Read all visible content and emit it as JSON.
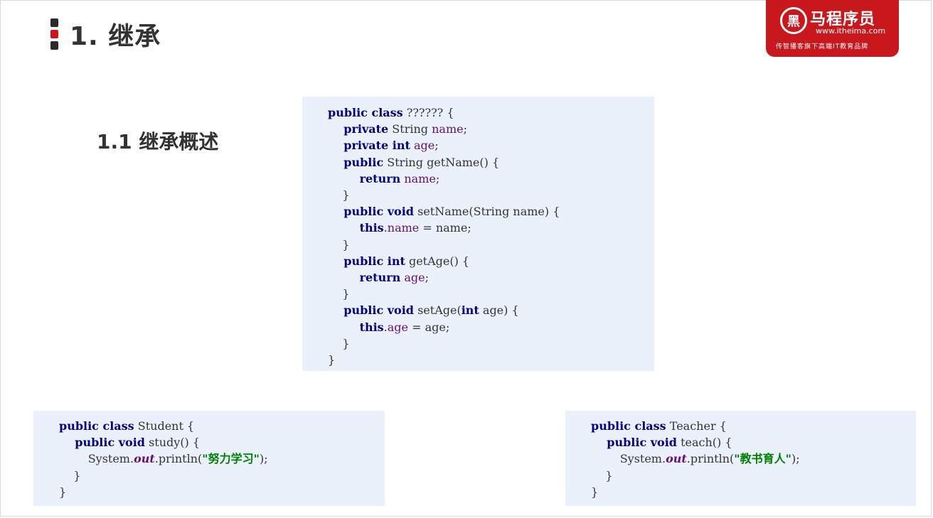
{
  "slide": {
    "title": "1. 继承",
    "subtitle": "1.1 继承概述"
  },
  "logo": {
    "icon_text": "黑",
    "name": "马程序员",
    "url": "www.itheima.com",
    "tagline": "传智播客旗下高端IT教育品牌"
  },
  "parent_code": {
    "lines": [
      [
        {
          "t": "public class",
          "c": "kw"
        },
        {
          "t": " ?????? {",
          "c": "plain"
        }
      ],
      [
        {
          "t": "    private",
          "c": "kw"
        },
        {
          "t": " String ",
          "c": "plain"
        },
        {
          "t": "name",
          "c": "fld"
        },
        {
          "t": ";",
          "c": "plain"
        }
      ],
      [
        {
          "t": "    private int",
          "c": "kw"
        },
        {
          "t": " ",
          "c": "plain"
        },
        {
          "t": "age",
          "c": "fld"
        },
        {
          "t": ";",
          "c": "plain"
        }
      ],
      [
        {
          "t": "    public",
          "c": "kw"
        },
        {
          "t": " String getName() {",
          "c": "plain"
        }
      ],
      [
        {
          "t": "        return",
          "c": "kw"
        },
        {
          "t": " ",
          "c": "plain"
        },
        {
          "t": "name",
          "c": "fld"
        },
        {
          "t": ";",
          "c": "plain"
        }
      ],
      [
        {
          "t": "    }",
          "c": "plain"
        }
      ],
      [
        {
          "t": "    public void",
          "c": "kw"
        },
        {
          "t": " setName(String name) {",
          "c": "plain"
        }
      ],
      [
        {
          "t": "        this",
          "c": "kw"
        },
        {
          "t": ".",
          "c": "plain"
        },
        {
          "t": "name",
          "c": "fld"
        },
        {
          "t": " = name;",
          "c": "plain"
        }
      ],
      [
        {
          "t": "    }",
          "c": "plain"
        }
      ],
      [
        {
          "t": "    public int",
          "c": "kw"
        },
        {
          "t": " getAge() {",
          "c": "plain"
        }
      ],
      [
        {
          "t": "        return",
          "c": "kw"
        },
        {
          "t": " ",
          "c": "plain"
        },
        {
          "t": "age",
          "c": "fld"
        },
        {
          "t": ";",
          "c": "plain"
        }
      ],
      [
        {
          "t": "    }",
          "c": "plain"
        }
      ],
      [
        {
          "t": "    public void",
          "c": "kw"
        },
        {
          "t": " setAge(",
          "c": "plain"
        },
        {
          "t": "int",
          "c": "kw"
        },
        {
          "t": " age) {",
          "c": "plain"
        }
      ],
      [
        {
          "t": "        this",
          "c": "kw"
        },
        {
          "t": ".",
          "c": "plain"
        },
        {
          "t": "age",
          "c": "fld"
        },
        {
          "t": " = age;",
          "c": "plain"
        }
      ],
      [
        {
          "t": "    }",
          "c": "plain"
        }
      ],
      [
        {
          "t": "}",
          "c": "plain"
        }
      ]
    ]
  },
  "student_code": {
    "lines": [
      [
        {
          "t": "public class",
          "c": "kw"
        },
        {
          "t": " Student {",
          "c": "plain"
        }
      ],
      [
        {
          "t": "    public void",
          "c": "kw"
        },
        {
          "t": " study() {",
          "c": "plain"
        }
      ],
      [
        {
          "t": "        System.",
          "c": "plain"
        },
        {
          "t": "out",
          "c": "static-fld"
        },
        {
          "t": ".println(",
          "c": "plain"
        },
        {
          "t": "\"努力学习\"",
          "c": "str"
        },
        {
          "t": ");",
          "c": "plain"
        }
      ],
      [
        {
          "t": "    }",
          "c": "plain"
        }
      ],
      [
        {
          "t": "}",
          "c": "plain"
        }
      ]
    ]
  },
  "teacher_code": {
    "lines": [
      [
        {
          "t": "public class",
          "c": "kw"
        },
        {
          "t": " Teacher {",
          "c": "plain"
        }
      ],
      [
        {
          "t": "    public void",
          "c": "kw"
        },
        {
          "t": " teach() {",
          "c": "plain"
        }
      ],
      [
        {
          "t": "        System.",
          "c": "plain"
        },
        {
          "t": "out",
          "c": "static-fld"
        },
        {
          "t": ".println(",
          "c": "plain"
        },
        {
          "t": "\"教书育人\"",
          "c": "str"
        },
        {
          "t": ");",
          "c": "plain"
        }
      ],
      [
        {
          "t": "    }",
          "c": "plain"
        }
      ],
      [
        {
          "t": "}",
          "c": "plain"
        }
      ]
    ]
  }
}
